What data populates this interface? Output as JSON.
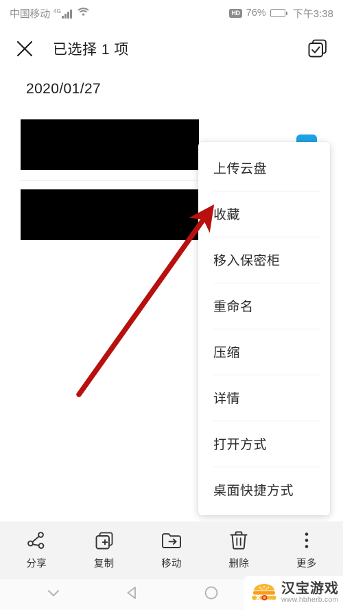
{
  "status_bar": {
    "carrier": "中国移动",
    "network_type": "4G",
    "signal_icon": "signal-bars-icon",
    "wifi_icon": "wifi-icon",
    "hd_badge": "HD",
    "battery_percent": "76%",
    "battery_level": 76,
    "battery_icon": "battery-icon",
    "time": "下午3:38"
  },
  "title_bar": {
    "close_icon": "close-icon",
    "title": "已选择 1 项",
    "select_all_icon": "select-all-icon"
  },
  "date_header": {
    "date": "2020/01/27"
  },
  "file_list": {
    "rows": [
      {
        "name": "redacted-file-row-1",
        "redacted": true,
        "selected": true
      },
      {
        "name": "redacted-file-row-2",
        "redacted": true,
        "selected": false
      }
    ],
    "checkbox_color": "#1fa2e6"
  },
  "context_menu": {
    "items": [
      {
        "label": "上传云盘"
      },
      {
        "label": "收藏"
      },
      {
        "label": "移入保密柜"
      },
      {
        "label": "重命名"
      },
      {
        "label": "压缩"
      },
      {
        "label": "详情"
      },
      {
        "label": "打开方式"
      },
      {
        "label": "桌面快捷方式"
      }
    ]
  },
  "annotation": {
    "arrow_color": "#b80f0f",
    "points_to": "收藏"
  },
  "bottom_toolbar": {
    "buttons": [
      {
        "label": "分享",
        "icon": "share-icon"
      },
      {
        "label": "复制",
        "icon": "copy-icon"
      },
      {
        "label": "移动",
        "icon": "move-icon"
      },
      {
        "label": "删除",
        "icon": "trash-icon"
      },
      {
        "label": "更多",
        "icon": "more-vertical-icon"
      }
    ]
  },
  "nav_bar": {
    "buttons": [
      {
        "name": "hide-navbar-button",
        "icon": "chevron-down-icon"
      },
      {
        "name": "back-button",
        "icon": "back-triangle-icon"
      },
      {
        "name": "home-button",
        "icon": "home-circle-icon"
      },
      {
        "name": "recents-button",
        "icon": "recents-square-icon"
      }
    ]
  },
  "watermark": {
    "title": "汉宝游戏",
    "url": "www.hbherb.com",
    "logo_icon": "burger-logo-icon",
    "logo_color": "#f5a623"
  }
}
